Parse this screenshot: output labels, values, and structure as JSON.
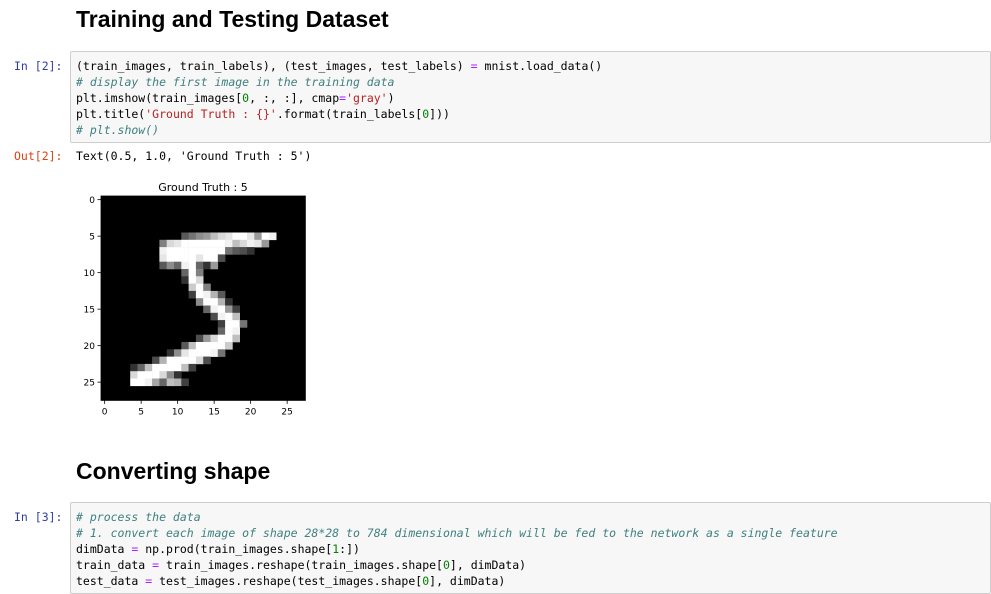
{
  "sections": {
    "heading1": "Training and Testing Dataset",
    "heading2": "Converting shape"
  },
  "cell2": {
    "prompt_in": "In [2]:",
    "prompt_out": "Out[2]:",
    "output": "Text(0.5, 1.0, 'Ground Truth : 5')",
    "code": [
      [
        {
          "t": "(train_images, train_labels), (test_images, test_labels) "
        },
        {
          "t": "=",
          "c": "o"
        },
        {
          "t": " mnist.load_data()"
        }
      ],
      [
        {
          "t": "# display the first image in the training data",
          "c": "c"
        }
      ],
      [
        {
          "t": "plt.imshow(train_images["
        },
        {
          "t": "0",
          "c": "n"
        },
        {
          "t": ", :, :], cmap"
        },
        {
          "t": "=",
          "c": "o"
        },
        {
          "t": "'gray'",
          "c": "s"
        },
        {
          "t": ")"
        }
      ],
      [
        {
          "t": "plt.title("
        },
        {
          "t": "'Ground Truth : {}'",
          "c": "s"
        },
        {
          "t": ".format(train_labels["
        },
        {
          "t": "0",
          "c": "n"
        },
        {
          "t": "]))"
        }
      ],
      [
        {
          "t": "# plt.show()",
          "c": "c"
        }
      ]
    ]
  },
  "cell3": {
    "prompt_in": "In [3]:",
    "code": [
      [
        {
          "t": "# process the data",
          "c": "c"
        }
      ],
      [
        {
          "t": "# 1. convert each image of shape 28*28 to 784 dimensional which will be fed to the network as a single feature",
          "c": "c"
        }
      ],
      [
        {
          "t": "dimData "
        },
        {
          "t": "=",
          "c": "o"
        },
        {
          "t": " np.prod(train_images.shape["
        },
        {
          "t": "1",
          "c": "n"
        },
        {
          "t": ":])"
        }
      ],
      [
        {
          "t": "train_data "
        },
        {
          "t": "=",
          "c": "o"
        },
        {
          "t": " train_images.reshape(train_images.shape["
        },
        {
          "t": "0",
          "c": "n"
        },
        {
          "t": "], dimData)"
        }
      ],
      [
        {
          "t": "test_data "
        },
        {
          "t": "=",
          "c": "o"
        },
        {
          "t": " test_images.reshape(test_images.shape["
        },
        {
          "t": "0",
          "c": "n"
        },
        {
          "t": "], dimData)"
        }
      ]
    ]
  },
  "plot": {
    "title": "Ground Truth : 5",
    "xticks": [
      0,
      5,
      10,
      15,
      20,
      25
    ],
    "yticks": [
      0,
      5,
      10,
      15,
      20,
      25
    ],
    "pixels": [
      [
        5,
        11,
        0.35
      ],
      [
        5,
        12,
        0.45
      ],
      [
        5,
        13,
        0.55
      ],
      [
        5,
        14,
        0.6
      ],
      [
        5,
        15,
        0.75
      ],
      [
        5,
        16,
        0.85
      ],
      [
        5,
        17,
        0.9
      ],
      [
        5,
        18,
        1
      ],
      [
        5,
        19,
        1
      ],
      [
        5,
        20,
        0.9
      ],
      [
        5,
        21,
        0.6
      ],
      [
        5,
        22,
        1
      ],
      [
        5,
        23,
        0.95
      ],
      [
        6,
        8,
        0.5
      ],
      [
        6,
        9,
        0.85
      ],
      [
        6,
        10,
        0.9
      ],
      [
        6,
        11,
        1
      ],
      [
        6,
        12,
        1
      ],
      [
        6,
        13,
        1
      ],
      [
        6,
        14,
        1
      ],
      [
        6,
        15,
        1
      ],
      [
        6,
        16,
        1
      ],
      [
        6,
        17,
        0.95
      ],
      [
        6,
        18,
        0.75
      ],
      [
        6,
        19,
        0.85
      ],
      [
        6,
        20,
        0.95
      ],
      [
        6,
        21,
        0.9
      ],
      [
        6,
        22,
        0.6
      ],
      [
        7,
        8,
        0.95
      ],
      [
        7,
        9,
        1
      ],
      [
        7,
        10,
        1
      ],
      [
        7,
        11,
        1
      ],
      [
        7,
        12,
        1
      ],
      [
        7,
        13,
        1
      ],
      [
        7,
        14,
        1
      ],
      [
        7,
        15,
        1
      ],
      [
        7,
        16,
        1
      ],
      [
        7,
        17,
        0.45
      ],
      [
        7,
        18,
        0.35
      ],
      [
        7,
        19,
        0.3
      ],
      [
        7,
        20,
        0.2
      ],
      [
        8,
        8,
        0.9
      ],
      [
        8,
        9,
        1
      ],
      [
        8,
        10,
        1
      ],
      [
        8,
        11,
        1
      ],
      [
        8,
        12,
        1
      ],
      [
        8,
        13,
        0.9
      ],
      [
        8,
        14,
        1
      ],
      [
        8,
        15,
        1
      ],
      [
        8,
        16,
        0.3
      ],
      [
        9,
        8,
        0.35
      ],
      [
        9,
        9,
        0.55
      ],
      [
        9,
        10,
        0.4
      ],
      [
        9,
        11,
        0.95
      ],
      [
        9,
        12,
        1
      ],
      [
        9,
        13,
        0.4
      ],
      [
        9,
        14,
        0.2
      ],
      [
        9,
        15,
        0.6
      ],
      [
        10,
        11,
        0.4
      ],
      [
        10,
        12,
        1
      ],
      [
        10,
        13,
        0.5
      ],
      [
        11,
        11,
        0.2
      ],
      [
        11,
        12,
        1
      ],
      [
        11,
        13,
        0.85
      ],
      [
        12,
        12,
        0.8
      ],
      [
        12,
        13,
        1
      ],
      [
        12,
        14,
        0.5
      ],
      [
        13,
        12,
        0.25
      ],
      [
        13,
        13,
        1
      ],
      [
        13,
        14,
        0.95
      ],
      [
        13,
        15,
        0.7
      ],
      [
        13,
        16,
        0.35
      ],
      [
        14,
        13,
        0.55
      ],
      [
        14,
        14,
        1
      ],
      [
        14,
        15,
        1
      ],
      [
        14,
        16,
        0.7
      ],
      [
        14,
        17,
        0.2
      ],
      [
        15,
        14,
        0.4
      ],
      [
        15,
        15,
        0.95
      ],
      [
        15,
        16,
        1
      ],
      [
        15,
        17,
        0.6
      ],
      [
        15,
        18,
        0.25
      ],
      [
        16,
        15,
        0.3
      ],
      [
        16,
        16,
        0.95
      ],
      [
        16,
        17,
        1
      ],
      [
        16,
        18,
        0.75
      ],
      [
        17,
        16,
        0.25
      ],
      [
        17,
        17,
        1
      ],
      [
        17,
        18,
        1
      ],
      [
        17,
        19,
        0.45
      ],
      [
        18,
        16,
        0.4
      ],
      [
        18,
        17,
        1
      ],
      [
        18,
        18,
        0.95
      ],
      [
        19,
        13,
        0.3
      ],
      [
        19,
        14,
        0.6
      ],
      [
        19,
        15,
        0.85
      ],
      [
        19,
        16,
        1
      ],
      [
        19,
        17,
        1
      ],
      [
        19,
        18,
        0.75
      ],
      [
        20,
        11,
        0.35
      ],
      [
        20,
        12,
        0.75
      ],
      [
        20,
        13,
        1
      ],
      [
        20,
        14,
        1
      ],
      [
        20,
        15,
        1
      ],
      [
        20,
        16,
        1
      ],
      [
        20,
        17,
        0.8
      ],
      [
        21,
        9,
        0.2
      ],
      [
        21,
        10,
        0.55
      ],
      [
        21,
        11,
        0.9
      ],
      [
        21,
        12,
        1
      ],
      [
        21,
        13,
        1
      ],
      [
        21,
        14,
        1
      ],
      [
        21,
        15,
        0.95
      ],
      [
        21,
        16,
        0.45
      ],
      [
        22,
        7,
        0.3
      ],
      [
        22,
        8,
        0.7
      ],
      [
        22,
        9,
        1
      ],
      [
        22,
        10,
        1
      ],
      [
        22,
        11,
        1
      ],
      [
        22,
        12,
        1
      ],
      [
        22,
        13,
        0.85
      ],
      [
        22,
        14,
        0.3
      ],
      [
        23,
        4,
        0.2
      ],
      [
        23,
        5,
        0.4
      ],
      [
        23,
        6,
        0.75
      ],
      [
        23,
        7,
        1
      ],
      [
        23,
        8,
        1
      ],
      [
        23,
        9,
        1
      ],
      [
        23,
        10,
        1
      ],
      [
        23,
        11,
        0.75
      ],
      [
        23,
        12,
        0.25
      ],
      [
        24,
        4,
        0.85
      ],
      [
        24,
        5,
        1
      ],
      [
        24,
        6,
        1
      ],
      [
        24,
        7,
        1
      ],
      [
        24,
        8,
        0.85
      ],
      [
        24,
        9,
        0.55
      ],
      [
        24,
        10,
        0.2
      ],
      [
        25,
        4,
        1
      ],
      [
        25,
        5,
        1
      ],
      [
        25,
        6,
        0.95
      ],
      [
        25,
        7,
        0.65
      ],
      [
        25,
        8,
        0.4
      ],
      [
        25,
        9,
        0.75
      ],
      [
        25,
        10,
        0.7
      ],
      [
        25,
        11,
        0.25
      ]
    ]
  }
}
